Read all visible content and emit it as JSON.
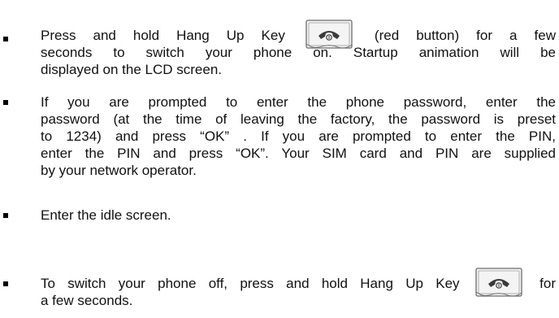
{
  "items": [
    {
      "lines": [
        [
          "Press and hold Hang Up Key",
          "(red button) for a few"
        ],
        "seconds to switch your phone on. Startup animation will be",
        "displayed on the LCD screen."
      ]
    },
    {
      "lines": [
        "If you are prompted to enter the phone password, enter the",
        "password (at the time of leaving the factory, the password is preset",
        "to 1234) and press “OK” . If you are prompted to enter the PIN,",
        "enter the PIN and press “OK”. Your SIM card and PIN are supplied",
        "by your network operator."
      ]
    },
    {
      "lines": [
        "Enter the idle screen."
      ]
    },
    {
      "lines": [
        [
          "To switch your phone off, press and hold Hang Up Key",
          "for"
        ],
        "a few seconds."
      ]
    }
  ],
  "icons": {
    "key": "hang-up-key-icon",
    "bullet": "square-bullet"
  },
  "colors": {
    "text": "#111111",
    "key_border": "#6b6b6b",
    "key_fill": "#f4f4f4"
  }
}
